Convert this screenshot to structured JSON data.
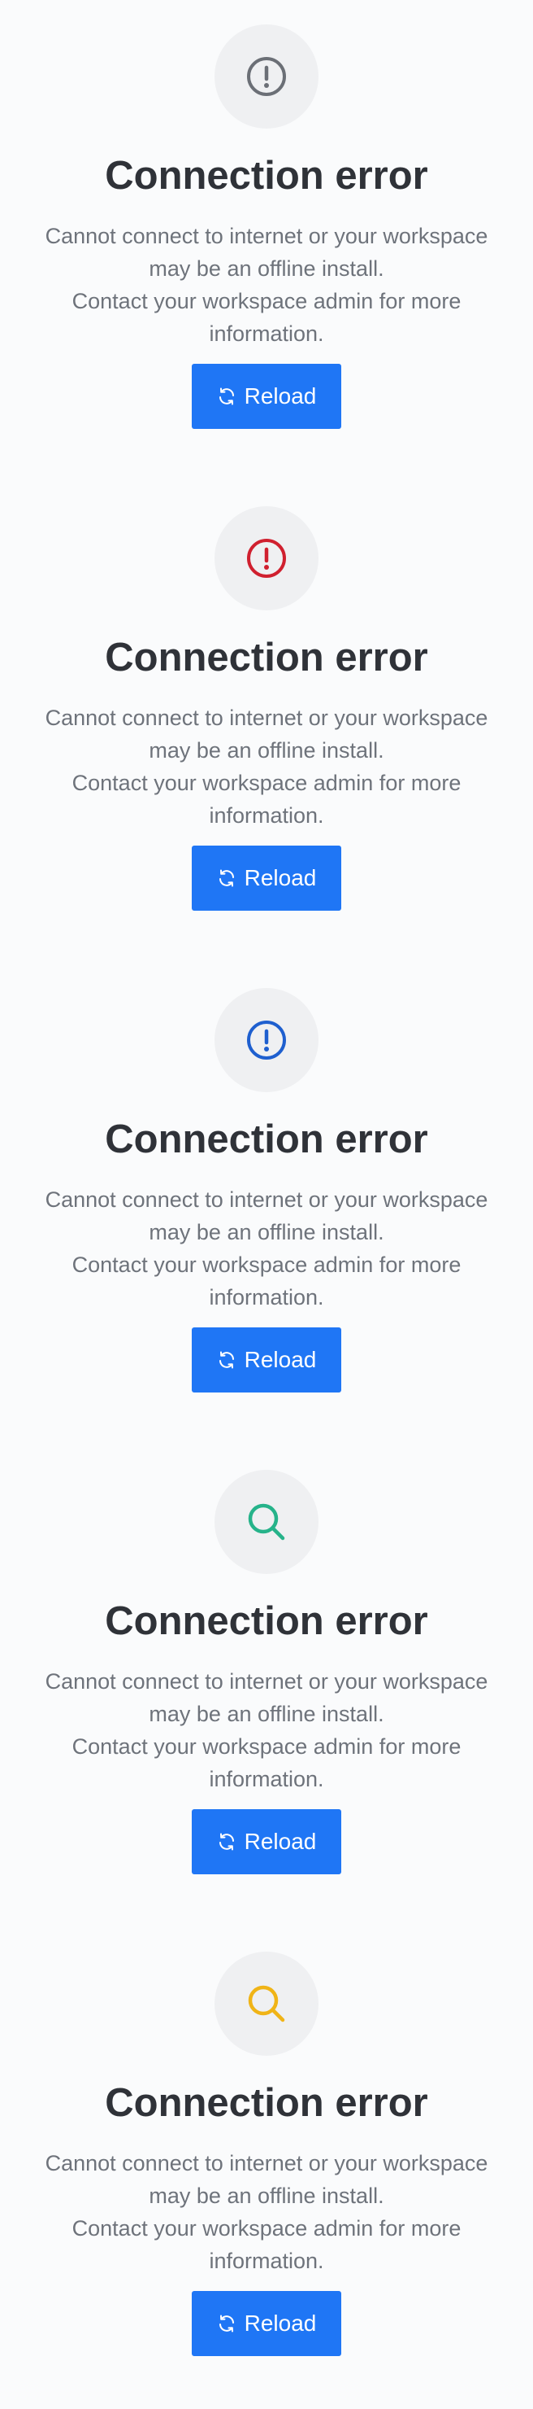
{
  "panels": [
    {
      "icon": "exclamation-circle-icon",
      "icon_color": "#6b6f76",
      "title": "Connection error",
      "description_line1": "Cannot connect to internet or your workspace may be an offline install.",
      "description_line2": "Contact your workspace admin for more information.",
      "button_label": "Reload",
      "button_icon": "refresh-icon"
    },
    {
      "icon": "exclamation-circle-icon",
      "icon_color": "#d0202f",
      "title": "Connection error",
      "description_line1": "Cannot connect to internet or your workspace may be an offline install.",
      "description_line2": "Contact your workspace admin for more information.",
      "button_label": "Reload",
      "button_icon": "refresh-icon"
    },
    {
      "icon": "exclamation-circle-icon",
      "icon_color": "#1e5fcf",
      "title": "Connection error",
      "description_line1": "Cannot connect to internet or your workspace may be an offline install.",
      "description_line2": "Contact your workspace admin for more information.",
      "button_label": "Reload",
      "button_icon": "refresh-icon"
    },
    {
      "icon": "search-icon",
      "icon_color": "#26b38a",
      "title": "Connection error",
      "description_line1": "Cannot connect to internet or your workspace may be an offline install.",
      "description_line2": "Contact your workspace admin for more information.",
      "button_label": "Reload",
      "button_icon": "refresh-icon"
    },
    {
      "icon": "search-icon",
      "icon_color": "#f0b417",
      "title": "Connection error",
      "description_line1": "Cannot connect to internet or your workspace may be an offline install.",
      "description_line2": "Contact your workspace admin for more information.",
      "button_label": "Reload",
      "button_icon": "refresh-icon"
    }
  ],
  "theme": {
    "button_color": "#1f76f5",
    "icon_circle_background": "#eff0f2"
  }
}
